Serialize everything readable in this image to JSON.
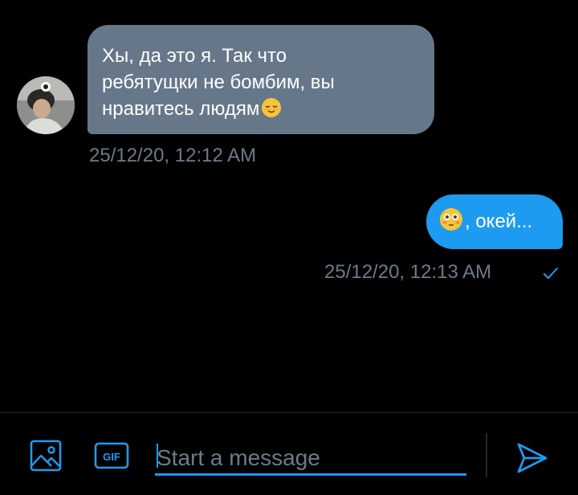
{
  "conversation": {
    "incoming": {
      "lines": [
        "Хы, да это я. Так что",
        "ребятущки не бомбим, вы",
        "нравитесь людям"
      ],
      "emoji": "😌",
      "timestamp": "25/12/20, 12:12 AM"
    },
    "outgoing": {
      "emoji": "😳",
      "text": ", окей...",
      "timestamp": "25/12/20, 12:13 AM",
      "status_icon": "check-icon"
    }
  },
  "composer": {
    "placeholder": "Start a message",
    "media_icon": "image-icon",
    "gif_label": "GIF",
    "send_icon": "send-icon"
  },
  "colors": {
    "background": "#000000",
    "incoming_bubble": "#66778a",
    "outgoing_bubble": "#1d9bf0",
    "accent": "#1d9bf0",
    "muted_text": "#6d7b89"
  }
}
